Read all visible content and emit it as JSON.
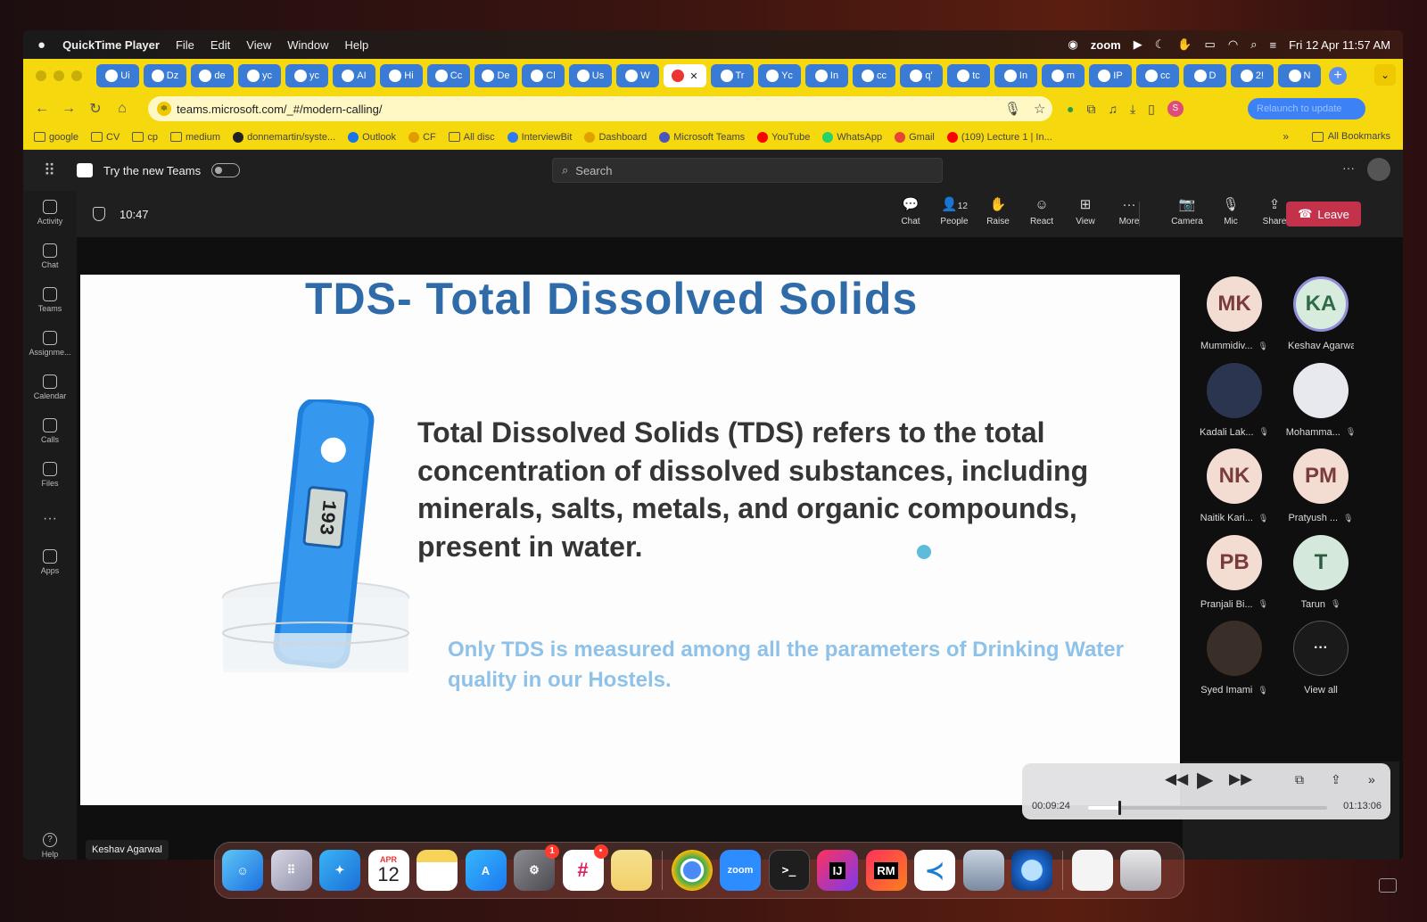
{
  "menubar": {
    "apple": "",
    "app": "QuickTime Player",
    "menus": [
      "File",
      "Edit",
      "View",
      "Window",
      "Help"
    ],
    "right": {
      "zoom": "zoom",
      "datetime": "Fri 12 Apr  11:57 AM"
    }
  },
  "browser": {
    "tabs": [
      "Ui",
      "Dz",
      "de",
      "yc",
      "yc",
      "AI",
      "Hi",
      "Cc",
      "De",
      "Cl",
      "Us",
      "W",
      "",
      "Tr",
      "Yc",
      "In",
      "cc",
      "q'",
      "tc",
      "In",
      "m",
      "IP",
      "cc",
      "D",
      "2!",
      "N"
    ],
    "active_tab_index": 12,
    "url": "teams.microsoft.com/_#/modern-calling/",
    "profile_initial": "S",
    "relaunch": "Relaunch to update",
    "bookmarks": [
      "google",
      "CV",
      "cp",
      "medium",
      "donnemartin/syste...",
      "Outlook",
      "CF",
      "All disc",
      "InterviewBit",
      "Dashboard",
      "Microsoft Teams",
      "YouTube",
      "WhatsApp",
      "Gmail",
      "(109) Lecture 1 | In..."
    ],
    "bookmarks_more": "»",
    "all_bookmarks": "All Bookmarks"
  },
  "teams": {
    "try_new": "Try the new Teams",
    "search_placeholder": "Search",
    "more": "···",
    "rail": [
      "Activity",
      "Chat",
      "Teams",
      "Assignme...",
      "Calendar",
      "Calls",
      "Files",
      "···",
      "Apps"
    ],
    "help": "Help"
  },
  "meeting": {
    "timer": "10:47",
    "people_count": "12",
    "toolbar": [
      "Chat",
      "People",
      "Raise",
      "React",
      "View",
      "More",
      "Camera",
      "Mic",
      "Share"
    ],
    "leave": "Leave",
    "speaker_tag": "Keshav Agarwal"
  },
  "slide": {
    "title": "TDS- Total Dissolved Solids",
    "body": "Total Dissolved Solids (TDS) refers to the total concentration of dissolved substances, including minerals, salts, metals, and organic compounds, present in water.",
    "note": "Only TDS is measured among all the parameters of Drinking Water quality in our Hostels.",
    "meter_reading": "193"
  },
  "participants": [
    {
      "initials": "MK",
      "name": "Mummidiv...",
      "muted": true
    },
    {
      "initials": "KA",
      "name": "Keshav Agarwal",
      "muted": false
    },
    {
      "initials": "",
      "name": "Kadali Lak...",
      "muted": true
    },
    {
      "initials": "",
      "name": "Mohamma...",
      "muted": true
    },
    {
      "initials": "NK",
      "name": "Naitik Kari...",
      "muted": true
    },
    {
      "initials": "PM",
      "name": "Pratyush ...",
      "muted": true
    },
    {
      "initials": "PB",
      "name": "Pranjali Bi...",
      "muted": true
    },
    {
      "initials": "T",
      "name": "Tarun",
      "muted": true
    },
    {
      "initials": "",
      "name": "Syed Imami",
      "muted": true
    },
    {
      "initials": "···",
      "name": "View all",
      "muted": false
    }
  ],
  "quicktime": {
    "elapsed": "00:09:24",
    "remaining": "01:13:06",
    "progress": 0.13
  },
  "dock": {
    "calendar_month": "APR",
    "calendar_day": "12",
    "zoom_label": "zoom",
    "intellij": "IJ",
    "rubymine": "RM",
    "settings_badge": "1",
    "slack_badge": "•"
  }
}
